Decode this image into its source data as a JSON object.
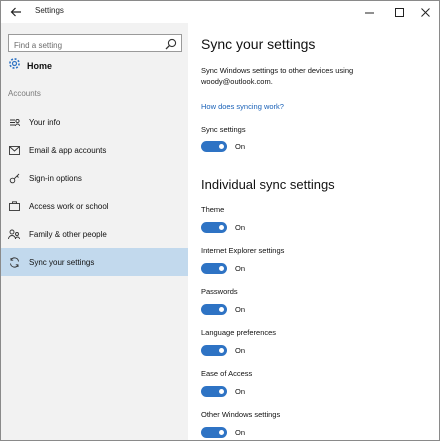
{
  "window": {
    "title": "Settings"
  },
  "sidebar": {
    "search_placeholder": "Find a setting",
    "home_label": "Home",
    "section": "Accounts",
    "items": [
      {
        "label": "Your info",
        "icon": "person-icon"
      },
      {
        "label": "Email & app accounts",
        "icon": "mail-icon"
      },
      {
        "label": "Sign-in options",
        "icon": "key-icon"
      },
      {
        "label": "Access work or school",
        "icon": "briefcase-icon"
      },
      {
        "label": "Family & other people",
        "icon": "people-icon"
      },
      {
        "label": "Sync your settings",
        "icon": "sync-icon",
        "selected": true
      }
    ]
  },
  "main": {
    "title": "Sync your settings",
    "description": "Sync Windows settings to other devices using woody@outlook.com.",
    "link": "How does syncing work?",
    "sync_settings": {
      "label": "Sync settings",
      "state": "On"
    },
    "individual_title": "Individual sync settings",
    "individual": [
      {
        "label": "Theme",
        "state": "On"
      },
      {
        "label": "Internet Explorer settings",
        "state": "On"
      },
      {
        "label": "Passwords",
        "state": "On"
      },
      {
        "label": "Language preferences",
        "state": "On"
      },
      {
        "label": "Ease of Access",
        "state": "On"
      },
      {
        "label": "Other Windows settings",
        "state": "On"
      }
    ]
  },
  "colors": {
    "accent": "#2e73c4",
    "selected_bg": "#c2d9ed",
    "link": "#1a62b8",
    "sidebar_bg": "#f2f2f2"
  }
}
